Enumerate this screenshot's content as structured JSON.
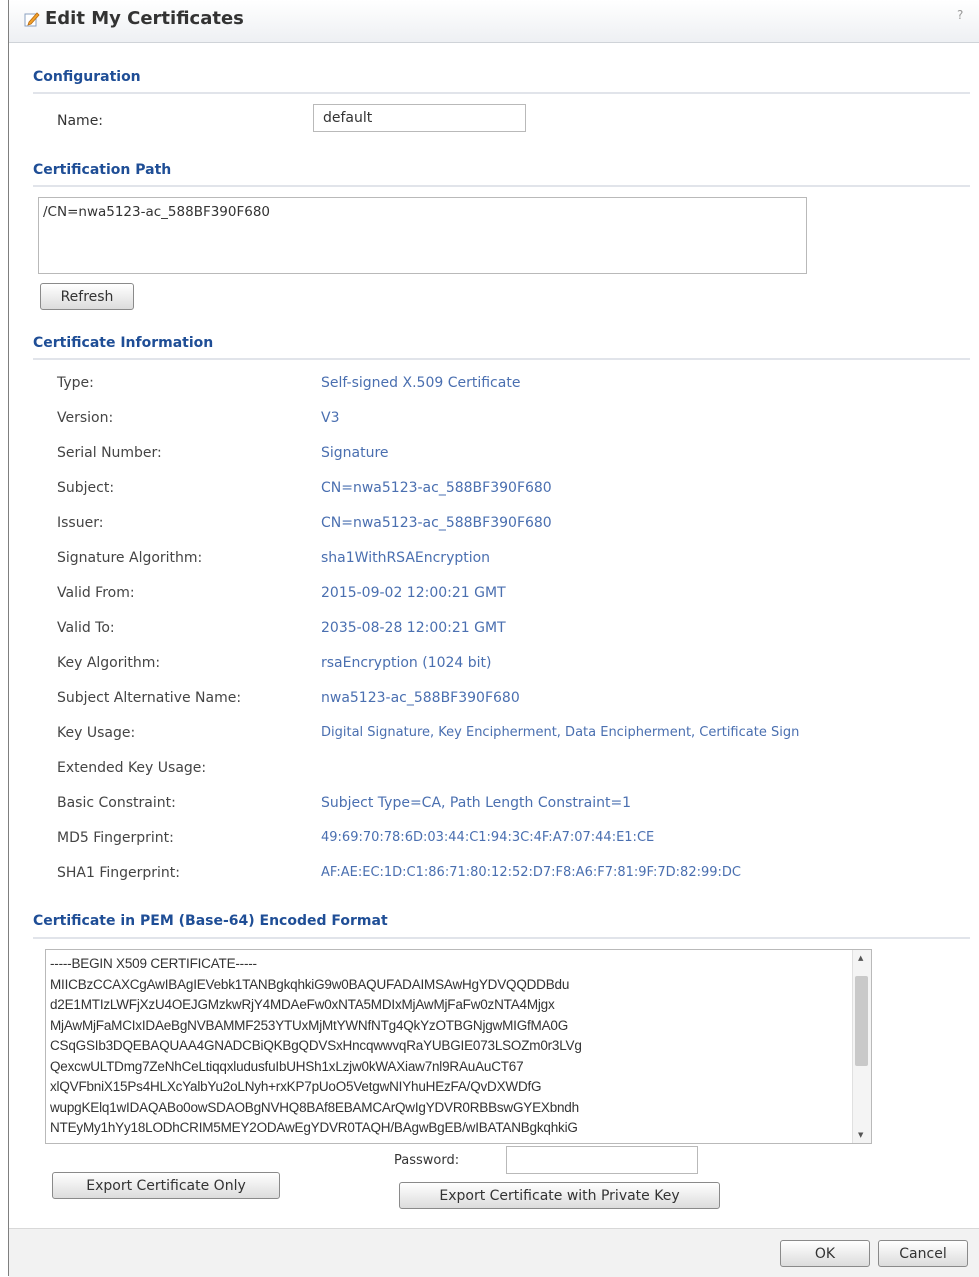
{
  "window": {
    "title": "Edit My Certificates",
    "help": "?"
  },
  "configuration": {
    "heading": "Configuration",
    "name_label": "Name:",
    "name_value": "default"
  },
  "cert_path": {
    "heading": "Certification Path",
    "value": "/CN=nwa5123-ac_588BF390F680",
    "refresh_label": "Refresh"
  },
  "cert_info": {
    "heading": "Certificate Information",
    "rows": [
      {
        "label": "Type:",
        "value": "Self-signed X.509 Certificate"
      },
      {
        "label": "Version:",
        "value": "V3"
      },
      {
        "label": "Serial Number:",
        "value": "Signature"
      },
      {
        "label": "Subject:",
        "value": "CN=nwa5123-ac_588BF390F680"
      },
      {
        "label": "Issuer:",
        "value": "CN=nwa5123-ac_588BF390F680"
      },
      {
        "label": "Signature Algorithm:",
        "value": "sha1WithRSAEncryption"
      },
      {
        "label": "Valid From:",
        "value": "2015-09-02 12:00:21 GMT"
      },
      {
        "label": "Valid To:",
        "value": "2035-08-28 12:00:21 GMT"
      },
      {
        "label": "Key Algorithm:",
        "value": "rsaEncryption (1024 bit)"
      },
      {
        "label": "Subject Alternative Name:",
        "value": "nwa5123-ac_588BF390F680"
      },
      {
        "label": "Key Usage:",
        "value": "Digital Signature, Key Encipherment, Data Encipherment, Certificate Sign"
      },
      {
        "label": "Extended Key Usage:",
        "value": ""
      },
      {
        "label": "Basic Constraint:",
        "value": "Subject Type=CA, Path Length Constraint=1"
      },
      {
        "label": "MD5 Fingerprint:",
        "value": "49:69:70:78:6D:03:44:C1:94:3C:4F:A7:07:44:E1:CE"
      },
      {
        "label": "SHA1 Fingerprint:",
        "value": "AF:AE:EC:1D:C1:86:71:80:12:52:D7:F8:A6:F7:81:9F:7D:82:99:DC"
      }
    ]
  },
  "pem": {
    "heading": "Certificate in PEM (Base-64) Encoded Format",
    "text": "-----BEGIN X509 CERTIFICATE-----\nMIICBzCCAXCgAwIBAgIEVebk1TANBgkqhkiG9w0BAQUFADAIMSAwHgYDVQQDDBdu\nd2E1MTIzLWFjXzU4OEJGMzkwRjY4MDAeFw0xNTA5MDIxMjAwMjFaFw0zNTA4Mjgx\nMjAwMjFaMCIxIDAeBgNVBAMMF253YTUxMjMtYWNfNTg4QkYzOTBGNjgwMIGfMA0G\nCSqGSIb3DQEBAQUAA4GNADCBiQKBgQDVSxHncqwwvqRaYUBGIE073LSOZm0r3LVg\nQexcwULTDmg7ZeNhCeLtiqqxludusfuIbUHSh1xLzjw0kWAXiaw7nl9RAuAuCT67\nxlQVFbniX15Ps4HLXcYalbYu2oLNyh+rxKP7pUoO5VetgwNIYhuHEzFA/QvDXWDfG\nwupgKElq1wIDAQABo0owSDAOBgNVHQ8BAf8EBAMCArQwIgYDVR0RBBswGYEXbndh\nNTEyMy1hYy18LODhCRIM5MEY2ODAwEgYDVR0TAQH/BAgwBgEB/wIBATANBgkqhkiG"
  },
  "password_label": "Password:",
  "password_value": "",
  "buttons": {
    "export_only": "Export Certificate Only",
    "export_key": "Export Certificate with Private Key",
    "ok": "OK",
    "cancel": "Cancel"
  }
}
